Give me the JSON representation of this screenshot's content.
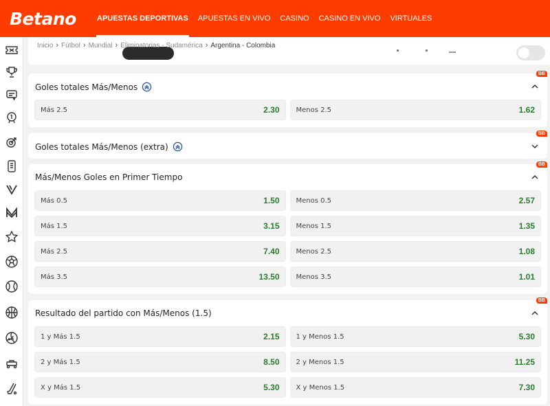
{
  "brand": {
    "logo_text": "Betano",
    "accent": "#ff3c00",
    "odds_color": "#2a7d2e"
  },
  "nav": {
    "items": [
      {
        "label": "APUESTAS DEPORTIVAS",
        "active": true
      },
      {
        "label": "APUESTAS EN VIVO"
      },
      {
        "label": "CASINO"
      },
      {
        "label": "CASINO EN VIVO"
      },
      {
        "label": "VIRTUALES"
      }
    ]
  },
  "sidebar": {
    "icons": [
      "ticket-icon",
      "trophy-icon",
      "coupon-icon",
      "medal-icon",
      "target-icon",
      "phone-icon",
      "v-logo-icon",
      "m-logo-icon",
      "star-icon",
      "soccer-ball-icon",
      "tennis-ball-icon",
      "basketball-icon",
      "volleyball-icon",
      "racing-icon",
      "hockey-icon"
    ]
  },
  "breadcrumb": {
    "items": [
      "Inicio",
      "Fútbol",
      "Mundial",
      "Eliminatorias - Sudamérica"
    ],
    "current": "Argentina - Colombia"
  },
  "markets": [
    {
      "title": "Goles totales Más/Menos",
      "badge": "BB",
      "has_bb_icon": true,
      "expanded": true,
      "rows": [
        [
          {
            "label": "Más 2.5",
            "value": "2.30"
          },
          {
            "label": "Menos 2.5",
            "value": "1.62"
          }
        ]
      ]
    },
    {
      "title": "Goles totales Más/Menos (extra)",
      "badge": "BB",
      "has_bb_icon": true,
      "expanded": false,
      "rows": []
    },
    {
      "title": "Más/Menos Goles en Primer Tiempo",
      "badge": "BB",
      "has_bb_icon": false,
      "expanded": true,
      "rows": [
        [
          {
            "label": "Más 0.5",
            "value": "1.50"
          },
          {
            "label": "Menos 0.5",
            "value": "2.57"
          }
        ],
        [
          {
            "label": "Más 1.5",
            "value": "3.15"
          },
          {
            "label": "Menos 1.5",
            "value": "1.35"
          }
        ],
        [
          {
            "label": "Más 2.5",
            "value": "7.40"
          },
          {
            "label": "Menos 2.5",
            "value": "1.08"
          }
        ],
        [
          {
            "label": "Más 3.5",
            "value": "13.50"
          },
          {
            "label": "Menos 3.5",
            "value": "1.01"
          }
        ]
      ]
    },
    {
      "title": "Resultado del partido con Más/Menos (1.5)",
      "badge": "BB",
      "has_bb_icon": false,
      "expanded": true,
      "rows": [
        [
          {
            "label": "1 y Más 1.5",
            "value": "2.15"
          },
          {
            "label": "1 y Menos 1.5",
            "value": "5.30"
          }
        ],
        [
          {
            "label": "2 y Más 1.5",
            "value": "8.50"
          },
          {
            "label": "2 y Menos 1.5",
            "value": "11.25"
          }
        ],
        [
          {
            "label": "X y Más 1.5",
            "value": "5.30"
          },
          {
            "label": "X y Menos 1.5",
            "value": "7.30"
          }
        ]
      ]
    }
  ]
}
